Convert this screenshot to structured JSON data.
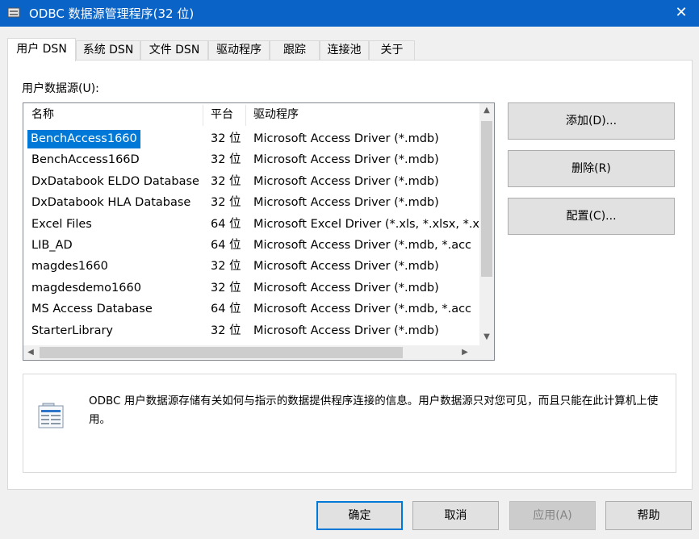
{
  "window": {
    "title": "ODBC 数据源管理程序(32 位)",
    "close_glyph": "✕",
    "app_icon": "odbc-app-icon"
  },
  "tabs": [
    {
      "label": "用户 DSN",
      "active": true
    },
    {
      "label": "系统 DSN"
    },
    {
      "label": "文件 DSN"
    },
    {
      "label": "驱动程序"
    },
    {
      "label": "跟踪"
    },
    {
      "label": "连接池"
    },
    {
      "label": "关于"
    }
  ],
  "panel": {
    "section_label": "用户数据源(U):",
    "columns": {
      "name": "名称",
      "bits": "平台",
      "driver": "驱动程序"
    },
    "rows": [
      {
        "name": "BenchAccess1660",
        "bits": "32 位",
        "driver": "Microsoft Access Driver (*.mdb)",
        "selected": true
      },
      {
        "name": "BenchAccess166D",
        "bits": "32 位",
        "driver": "Microsoft Access Driver (*.mdb)"
      },
      {
        "name": "DxDatabook ELDO Database",
        "bits": "32 位",
        "driver": "Microsoft Access Driver (*.mdb)"
      },
      {
        "name": "DxDatabook HLA Database",
        "bits": "32 位",
        "driver": "Microsoft Access Driver (*.mdb)"
      },
      {
        "name": "Excel Files",
        "bits": "64 位",
        "driver": "Microsoft Excel Driver (*.xls, *.xlsx, *.xl"
      },
      {
        "name": "LIB_AD",
        "bits": "64 位",
        "driver": "Microsoft Access Driver (*.mdb, *.acc"
      },
      {
        "name": "magdes1660",
        "bits": "32 位",
        "driver": "Microsoft Access Driver (*.mdb)"
      },
      {
        "name": "magdesdemo1660",
        "bits": "32 位",
        "driver": "Microsoft Access Driver (*.mdb)"
      },
      {
        "name": "MS Access Database",
        "bits": "64 位",
        "driver": "Microsoft Access Driver (*.mdb, *.acc"
      },
      {
        "name": "StarterLibrary",
        "bits": "32 位",
        "driver": "Microsoft Access Driver (*.mdb)"
      }
    ],
    "buttons": {
      "add": "添加(D)...",
      "remove": "删除(R)",
      "configure": "配置(C)..."
    },
    "info_text": "ODBC 用户数据源存储有关如何与指示的数据提供程序连接的信息。用户数据源只对您可见，而且只能在此计算机上使用。"
  },
  "footer": {
    "ok": "确定",
    "cancel": "取消",
    "apply": "应用(A)",
    "help": "帮助"
  },
  "colors": {
    "titlebar": "#0a64c8",
    "selection": "#0078d7",
    "default_button_border": "#0078d7"
  }
}
